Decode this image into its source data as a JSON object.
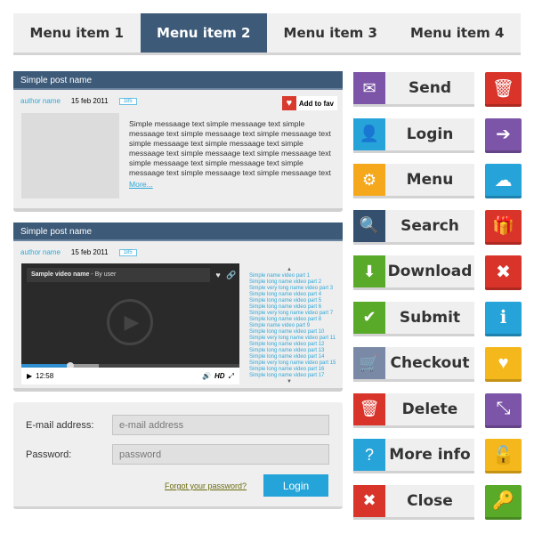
{
  "menu": {
    "items": [
      "Menu item 1",
      "Menu item 2",
      "Menu item 3",
      "Menu item 4"
    ],
    "active": 1
  },
  "post1": {
    "title": "Simple post name",
    "author": "author name",
    "date": "15 feb 2011",
    "comments": "185",
    "fav_label": "Add to fav",
    "message": "Simple messaage text simple messaage text simple messaage text simple messaage text simple messaage text simple messaage text simple messaage text simple messaage text simple messaage text simple messaage text simple messaage text simple messaage text simple messaage text simple messaage text simple messaage text",
    "more": "More..."
  },
  "post2": {
    "title": "Simple post name",
    "author": "author name",
    "date": "15 feb 2011",
    "comments": "185",
    "video": {
      "title": "Sample video name",
      "by": " - By user",
      "time": "12:58",
      "hd": "HD",
      "progress_percent": 22
    },
    "playlist": [
      "Simple name video part 1",
      "Simple long name video part 2",
      "Simple very long name video part 3",
      "Simple long name video part 4",
      "Simple long name video part 5",
      "Simple long name video part 6",
      "Simple very long name video part 7",
      "Simple long name video part 8",
      "Simple name video part 9",
      "Simple long name video part 10",
      "Simple very long name video part 11",
      "Simple long name video part 12",
      "Simple long name video part 13",
      "Simple long name video part 14",
      "Simple very long name video part 15",
      "Simple long name video part 16",
      "Simple long name video part 17"
    ]
  },
  "form": {
    "email_label": "E-mail address:",
    "email_placeholder": "e-mail address",
    "password_label": "Password:",
    "password_placeholder": "password",
    "forgot": "Forgot your password?",
    "login": "Login"
  },
  "buttons": [
    {
      "label": "Send",
      "icon": "envelope-icon",
      "glyph": "✉",
      "color": "#7d55a8"
    },
    {
      "label": "Login",
      "icon": "user-icon",
      "glyph": "👤",
      "color": "#26a3d9"
    },
    {
      "label": "Menu",
      "icon": "gears-icon",
      "glyph": "⚙",
      "color": "#f5a81c"
    },
    {
      "label": "Search",
      "icon": "search-icon",
      "glyph": "🔍",
      "color": "#34506e"
    },
    {
      "label": "Download",
      "icon": "download-icon",
      "glyph": "⬇",
      "color": "#5aaa2a"
    },
    {
      "label": "Submit",
      "icon": "check-icon",
      "glyph": "✔",
      "color": "#5aaa2a"
    },
    {
      "label": "Checkout",
      "icon": "cart-icon",
      "glyph": "🛒",
      "color": "#7a8aa6"
    },
    {
      "label": "Delete",
      "icon": "trash-icon",
      "glyph": "🗑",
      "color": "#d9342a"
    },
    {
      "label": "More info",
      "icon": "question-icon",
      "glyph": "?",
      "color": "#26a3d9"
    },
    {
      "label": "Close",
      "icon": "close-icon",
      "glyph": "✖",
      "color": "#d9342a"
    }
  ],
  "icon_buttons": [
    {
      "icon": "trash-icon",
      "glyph": "🗑",
      "color": "#d9342a"
    },
    {
      "icon": "sign-in-icon",
      "glyph": "➔",
      "color": "#7d55a8"
    },
    {
      "icon": "cloud-upload-icon",
      "glyph": "☁",
      "color": "#26a3d9"
    },
    {
      "icon": "gift-icon",
      "glyph": "🎁",
      "color": "#d9342a"
    },
    {
      "icon": "close-icon",
      "glyph": "✖",
      "color": "#d9342a"
    },
    {
      "icon": "info-icon",
      "glyph": "ℹ",
      "color": "#26a3d9"
    },
    {
      "icon": "heart-icon",
      "glyph": "♥",
      "color": "#f5b81c"
    },
    {
      "icon": "expand-icon",
      "glyph": "⤡",
      "color": "#7d55a8"
    },
    {
      "icon": "lock-icon",
      "glyph": "🔓",
      "color": "#f5b81c"
    },
    {
      "icon": "key-icon",
      "glyph": "🔑",
      "color": "#5aaa2a"
    }
  ]
}
